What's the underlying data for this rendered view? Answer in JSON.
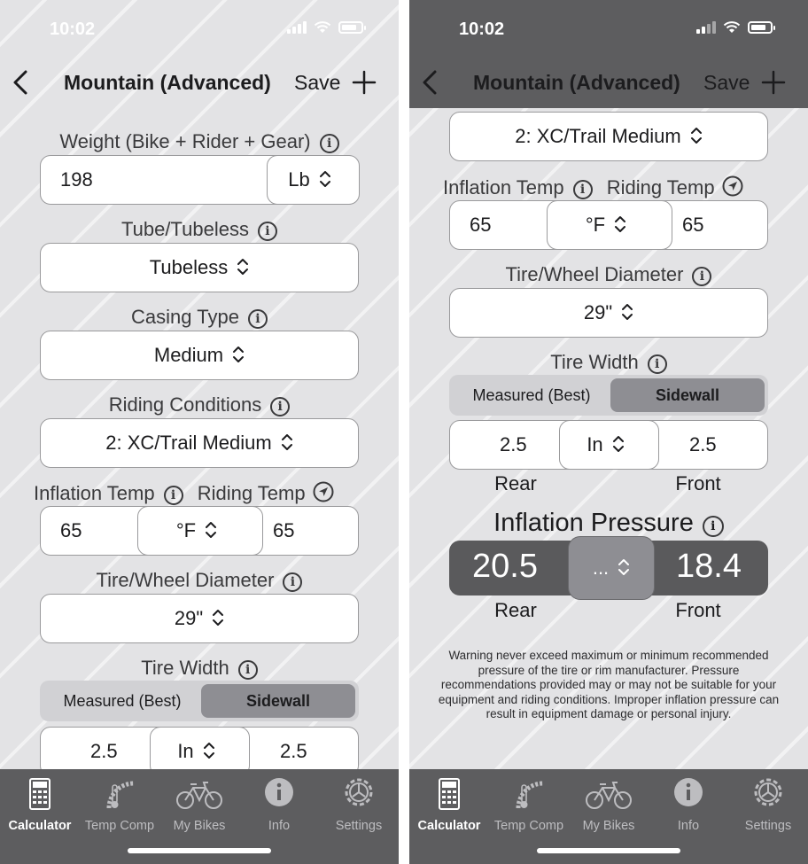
{
  "status_bar": {
    "time": "10:02"
  },
  "nav": {
    "title": "Mountain (Advanced)",
    "save_label": "Save"
  },
  "form": {
    "weight": {
      "label": "Weight (Bike + Rider + Gear)",
      "value": "198",
      "unit": "Lb"
    },
    "tube": {
      "label": "Tube/Tubeless",
      "value": "Tubeless"
    },
    "casing": {
      "label": "Casing Type",
      "value": "Medium"
    },
    "conditions": {
      "label": "Riding Conditions",
      "value": "2: XC/Trail Medium"
    },
    "temp": {
      "inflation_label": "Inflation Temp",
      "riding_label": "Riding Temp",
      "inflation_value": "65",
      "unit": "°F",
      "riding_value": "65"
    },
    "diameter": {
      "label": "Tire/Wheel Diameter",
      "value": "29\""
    },
    "width": {
      "label": "Tire Width",
      "options": [
        "Measured (Best)",
        "Sidewall"
      ],
      "selected": "Sidewall",
      "rear_value": "2.5",
      "unit": "In",
      "front_value": "2.5",
      "rear_label": "Rear",
      "front_label": "Front"
    }
  },
  "pressure": {
    "label": "Inflation Pressure",
    "rear": "20.5",
    "unit": "...",
    "front": "18.4",
    "rear_label": "Rear",
    "front_label": "Front"
  },
  "warning": "Warning never exceed maximum or minimum recommended pressure of the tire or rim manufacturer. Pressure recommendations provided may or may not be suitable for your equipment and riding conditions. Improper inflation pressure can result in equipment damage or personal injury.",
  "tabs": [
    {
      "label": "Calculator",
      "icon": "calculator-icon",
      "active": true
    },
    {
      "label": "Temp Comp",
      "icon": "thermometer-gauge-icon",
      "active": false
    },
    {
      "label": "My Bikes",
      "icon": "bicycle-icon",
      "active": false
    },
    {
      "label": "Info",
      "icon": "info-icon",
      "active": false
    },
    {
      "label": "Settings",
      "icon": "gear-icon",
      "active": false
    }
  ],
  "colors": {
    "tabbar": "#5d5d5f",
    "background": "#e3e3e5",
    "selected_segment": "#8e8e93",
    "pressure_box": "#5a5a5c"
  }
}
